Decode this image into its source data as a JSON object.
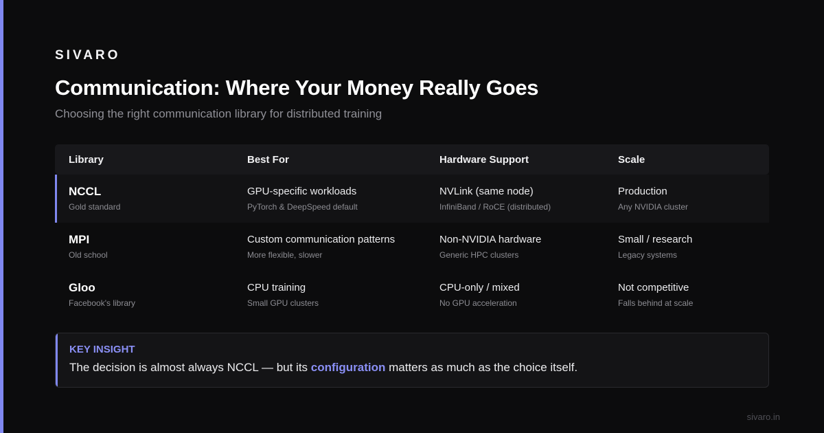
{
  "brand": "SIVARO",
  "title": "Communication: Where Your Money Really Goes",
  "subtitle": "Choosing the right communication library for distributed training",
  "table": {
    "headers": [
      "Library",
      "Best For",
      "Hardware Support",
      "Scale"
    ],
    "rows": [
      {
        "library": "NCCL",
        "library_sub": "Gold standard",
        "best_for": "GPU-specific workloads",
        "best_for_sub": "PyTorch & DeepSpeed default",
        "hardware": "NVLink (same node)",
        "hardware_sub": "InfiniBand / RoCE (distributed)",
        "scale": "Production",
        "scale_sub": "Any NVIDIA cluster"
      },
      {
        "library": "MPI",
        "library_sub": "Old school",
        "best_for": "Custom communication patterns",
        "best_for_sub": "More flexible, slower",
        "hardware": "Non-NVIDIA hardware",
        "hardware_sub": "Generic HPC clusters",
        "scale": "Small / research",
        "scale_sub": "Legacy systems"
      },
      {
        "library": "Gloo",
        "library_sub": "Facebook's library",
        "best_for": "CPU training",
        "best_for_sub": "Small GPU clusters",
        "hardware": "CPU-only / mixed",
        "hardware_sub": "No GPU acceleration",
        "scale": "Not competitive",
        "scale_sub": "Falls behind at scale"
      }
    ]
  },
  "insight": {
    "label": "KEY INSIGHT",
    "text_before": "The decision is almost always NCCL — but its ",
    "highlight": "configuration",
    "text_after": " matters as much as the choice itself."
  },
  "footer": "sivaro.in",
  "colors": {
    "accent": "#8088f0",
    "background": "#0c0c0d"
  }
}
